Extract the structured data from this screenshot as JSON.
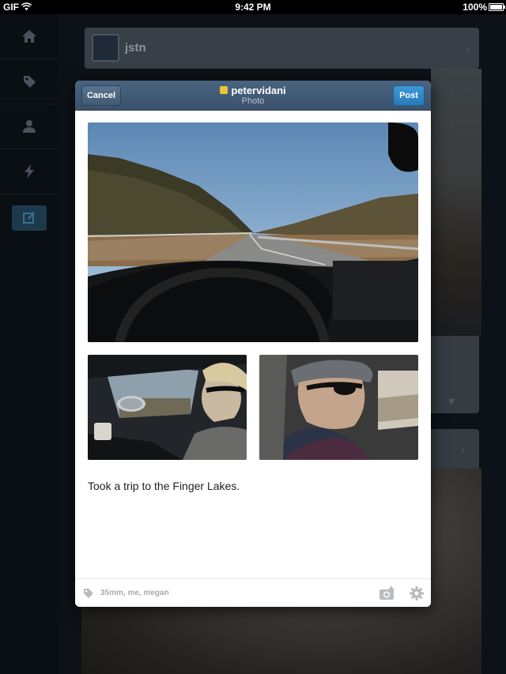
{
  "status_bar": {
    "carrier": "GIF",
    "time": "9:42 PM",
    "battery": "100%"
  },
  "sidebar": {
    "items": [
      {
        "icon": "home-icon"
      },
      {
        "icon": "tag-icon"
      },
      {
        "icon": "person-icon"
      },
      {
        "icon": "lightning-icon"
      },
      {
        "icon": "compose-icon"
      }
    ]
  },
  "background": {
    "post_author": "jstn"
  },
  "modal": {
    "cancel_label": "Cancel",
    "post_label": "Post",
    "blog_name": "petervidani",
    "post_type": "Photo",
    "caption": "Took a trip to the Finger Lakes.",
    "tags": "35mm, me, megan"
  },
  "colors": {
    "header": "#3f5873",
    "post_button": "#2f8bc8",
    "background": "#0d1218"
  }
}
